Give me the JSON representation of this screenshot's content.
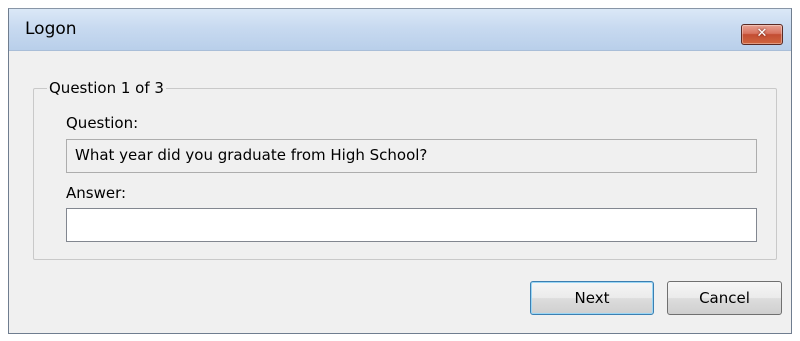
{
  "window": {
    "title": "Logon",
    "close_label": "✕"
  },
  "group": {
    "legend": "Question 1 of 3"
  },
  "question": {
    "label": "Question:",
    "text": "What year did you graduate from High School?"
  },
  "answer": {
    "label": "Answer:",
    "value": "",
    "placeholder": ""
  },
  "buttons": {
    "next": "Next",
    "cancel": "Cancel"
  }
}
